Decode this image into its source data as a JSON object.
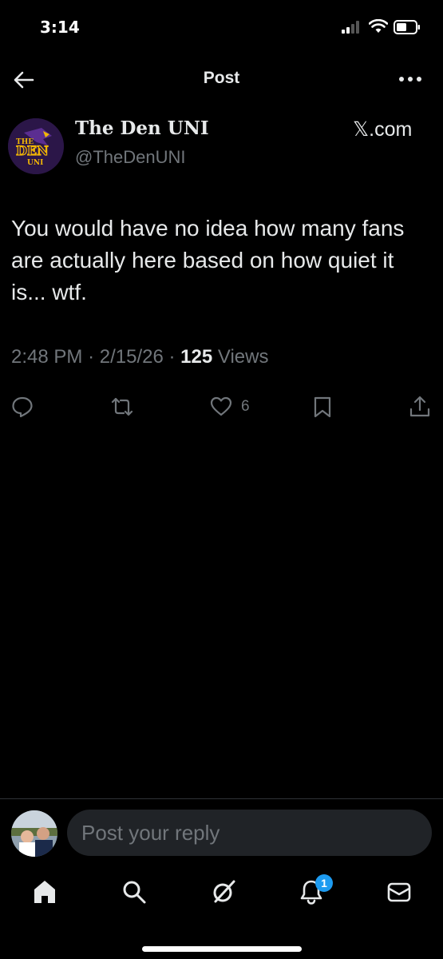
{
  "status_bar": {
    "time": "3:14"
  },
  "header": {
    "title": "Post"
  },
  "post": {
    "display_name": "The Den UNI",
    "handle": "@TheDenUNI",
    "source_label": "𝕏.com",
    "avatar_text_top": "THE",
    "avatar_text_mid": "DEN",
    "avatar_text_bottom": "UNI",
    "text": "You would have no idea how many fans are actually here based on how quiet it is... wtf.",
    "time": "2:48 PM",
    "date": "2/15/26",
    "views_count": "125",
    "views_label": "Views",
    "separator": "·"
  },
  "actions": {
    "like_count": "6",
    "icons": [
      "reply-icon",
      "retweet-icon",
      "like-icon",
      "bookmark-icon",
      "share-icon"
    ]
  },
  "reply": {
    "placeholder": "Post your reply"
  },
  "tabs": {
    "icons": [
      "home-icon",
      "search-icon",
      "grok-icon",
      "notifications-icon",
      "messages-icon"
    ],
    "notification_badge": "1"
  },
  "colors": {
    "background": "#000000",
    "text": "#e7e9ea",
    "muted": "#71767b",
    "accent": "#1d9bf0"
  }
}
